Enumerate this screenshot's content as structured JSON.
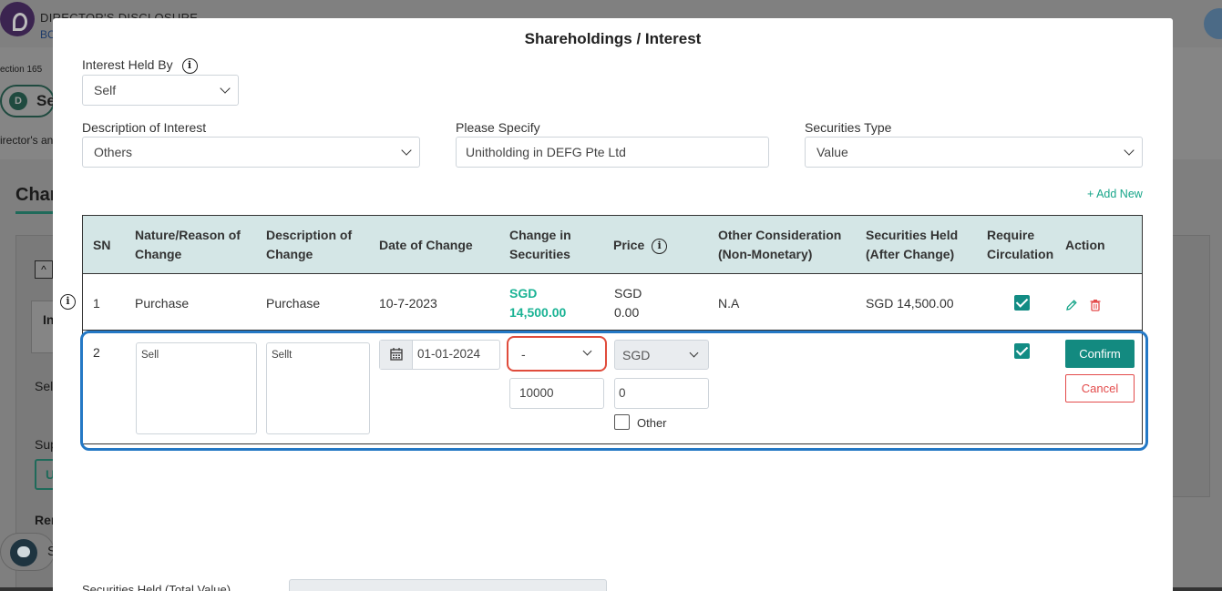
{
  "background": {
    "title": "DIRECTOR'S DISCLOSURE",
    "subtitle": "BC",
    "section": "ection 165",
    "badge_letter": "D",
    "badge_text": "Se",
    "directors_text": "irector's an",
    "changes_heading": "Char",
    "collapse_symbol": "^",
    "tab_text": "In",
    "sel_text": "Sel",
    "sup_text": "Sup",
    "u_button": "U",
    "rem_text": "Rer",
    "chat_letter": "S"
  },
  "modal": {
    "title": "Shareholdings / Interest",
    "interest_held_by": {
      "label": "Interest Held By",
      "value": "Self"
    },
    "description_of_interest": {
      "label": "Description of Interest",
      "value": "Others"
    },
    "please_specify": {
      "label": "Please Specify",
      "value": "Unitholding in DEFG Pte Ltd"
    },
    "securities_type": {
      "label": "Securities Type",
      "value": "Value"
    },
    "add_new": "+ Add New",
    "info_glyph": "i",
    "table": {
      "headers": {
        "sn": "SN",
        "nature": [
          "Nature/Reason of",
          "Change"
        ],
        "description": [
          "Description of",
          "Change"
        ],
        "date": "Date of Change",
        "change_in_securities": [
          "Change in",
          "Securities"
        ],
        "price": "Price",
        "other_consideration": [
          "Other Consideration",
          "(Non-Monetary)"
        ],
        "securities_held": [
          "Securities Held",
          "(After Change)"
        ],
        "require_circulation": [
          "Require",
          "Circulation"
        ],
        "action": "Action"
      },
      "row1": {
        "sn": "1",
        "nature": "Purchase",
        "description": "Purchase",
        "date": "10-7-2023",
        "change_currency": "SGD",
        "change_amount": "14,500.00",
        "price_currency": "SGD",
        "price_amount": "0.00",
        "other_consideration": "N.A",
        "securities_held": "SGD 14,500.00",
        "require_circulation": true
      },
      "row2": {
        "sn": "2",
        "nature": "Sell",
        "description": "Sellt",
        "date": "01-01-2024",
        "change_select": "-",
        "change_amount": "10000",
        "price_currency": "SGD",
        "price_amount": "0",
        "other_checkbox_label": "Other",
        "other_checked": false,
        "require_circulation": true,
        "confirm_label": "Confirm",
        "cancel_label": "Cancel"
      }
    },
    "securities_held_total_label": "Securities Held (Total Value)"
  },
  "colors": {
    "accent_teal": "#138a80",
    "green_value": "#1ab394",
    "cancel_red": "#e34b4b",
    "highlight_red": "#e04c3c",
    "highlight_blue": "#2478c5",
    "table_header_bg": "#d4e6e6"
  }
}
